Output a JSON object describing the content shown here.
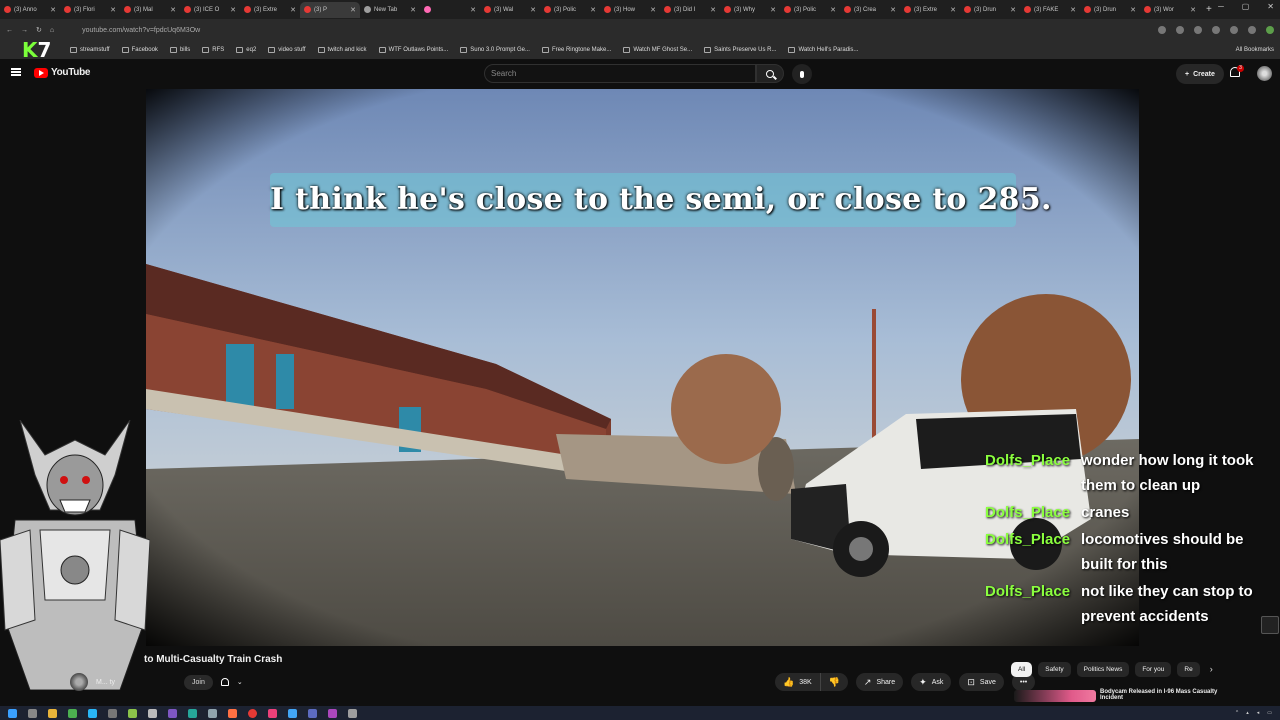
{
  "browser": {
    "tabs": [
      {
        "label": "(3) Anno"
      },
      {
        "label": "(3) Flori"
      },
      {
        "label": "(3) Mal"
      },
      {
        "label": "(3) ICE O"
      },
      {
        "label": "(3) Extre"
      },
      {
        "label": "(3) P"
      },
      {
        "label": "New Tab"
      },
      {
        "label": ""
      },
      {
        "label": "(3) Wal"
      },
      {
        "label": "(3) Polic"
      },
      {
        "label": "(3) How"
      },
      {
        "label": "(3) Did I"
      },
      {
        "label": "(3) Why"
      },
      {
        "label": "(3) Polic"
      },
      {
        "label": "(3) Crea"
      },
      {
        "label": "(3) Extre"
      },
      {
        "label": "(3) Drun"
      },
      {
        "label": "(3) FAKE"
      },
      {
        "label": "(3) Drun"
      },
      {
        "label": "(3) Wor"
      }
    ],
    "url": "youtube.com/watch?v=fpdcUq6M3Ow",
    "bookmarks": [
      "streamstuff",
      "Facebook",
      "bills",
      "RFS",
      "eq2",
      "video stuff",
      "twitch and kick",
      "WTF Outlaws Points...",
      "Suno 3.0 Prompt Ge...",
      "Free Ringtone Make...",
      "Watch MF Ghost Se...",
      "Saints Preserve Us R...",
      "Watch Hell's Paradis..."
    ],
    "all_bookmarks": "All Bookmarks"
  },
  "youtube": {
    "logo_text": "YouTube",
    "search_placeholder": "Search",
    "create_label": "Create",
    "notif_count": "3"
  },
  "video": {
    "caption": "I think he's close to the semi, or close to 285."
  },
  "chat": [
    {
      "user": "Dolfs_Place",
      "text": "wonder how long it took them to clean up"
    },
    {
      "user": "Dolfs_Place",
      "text": "cranes"
    },
    {
      "user": "Dolfs_Place",
      "text": "locomotives should be built for this"
    },
    {
      "user": "Dolfs_Place",
      "text": "not like they can stop to prevent accidents"
    }
  ],
  "below_video": {
    "title": "to Multi-Casualty Train Crash",
    "channel_name": "M...                ty",
    "join_label": "Join",
    "likes": "38K",
    "share_label": "Share",
    "ask_label": "Ask",
    "save_label": "Save",
    "chips": [
      "All",
      "Safety",
      "Politics News",
      "For you",
      "Re"
    ],
    "rec_title": "Bodycam Released in I-96 Mass Casualty Incident"
  },
  "colors": {
    "chat_user": "#8bff3f",
    "yt_red": "#ff0000",
    "caption_bg": "#6ec8d7"
  }
}
